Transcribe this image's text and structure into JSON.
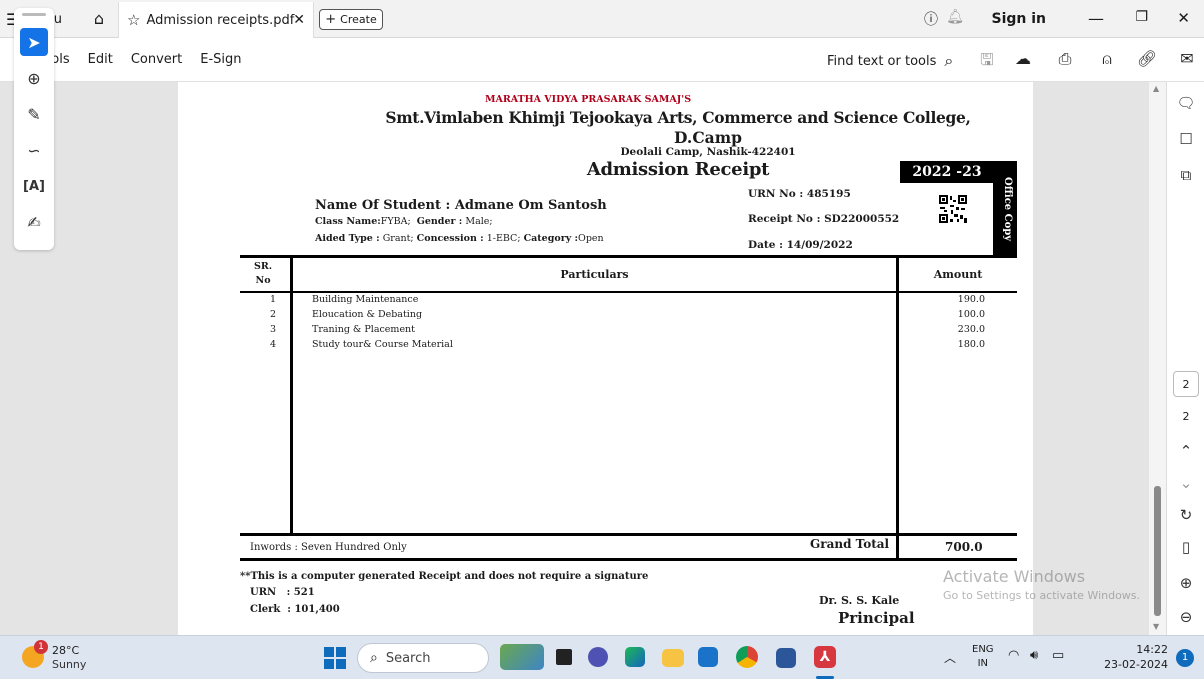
{
  "titlebar": {
    "menu_label": "Menu",
    "tab_title": "Admission receipts.pdf",
    "create_label": "Create",
    "sign_in": "Sign in"
  },
  "toolbar": {
    "items": [
      "All tools",
      "Edit",
      "Convert",
      "E-Sign"
    ],
    "find_label": "Find text or tools"
  },
  "page_nav": {
    "current_page": "2",
    "total_pages": "2"
  },
  "receipt": {
    "society": "MARATHA VIDYA PRASARAK SAMAJ'S",
    "college_line1": "Smt.Vimlaben Khimji Tejookaya Arts, Commerce and Science College,",
    "college_line2": "D.Camp",
    "address": "Deolali Camp, Nashik-422401",
    "title": "Admission Receipt",
    "year": "2022 -23",
    "copy_label": "Office Copy",
    "student_name": "Name Of Student : Admane Om Santosh",
    "class_prefix": "Class Name:",
    "class_value": "FYBA;",
    "gender_prefix": "Gender :",
    "gender_value": "Male;",
    "aided_prefix": "Aided Type :",
    "aided_value": "Grant;",
    "concession_prefix": "Concession :",
    "concession_value": "1-EBC;",
    "category_prefix": "Category :",
    "category_value": "Open",
    "urn_no": "URN No : 485195",
    "receipt_no": "Receipt No : SD22000552",
    "date": "Date : 14/09/2022",
    "table_headers": {
      "sr_line1": "SR.",
      "sr_line2": "No",
      "particulars": "Particulars",
      "amount": "Amount"
    },
    "rows": [
      {
        "sr": "1",
        "particular": "Building Maintenance",
        "amount": "190.0"
      },
      {
        "sr": "2",
        "particular": "Eloucation & Debating",
        "amount": "100.0"
      },
      {
        "sr": "3",
        "particular": "Traning & Placement",
        "amount": "230.0"
      },
      {
        "sr": "4",
        "particular": "Study tour& Course Material",
        "amount": "180.0"
      }
    ],
    "inwords": "Inwords : Seven Hundred Only",
    "grand_total_label": "Grand Total",
    "grand_total_value": "700.0",
    "note": "**This is a computer generated Receipt and does not require a signature",
    "urn_label": "URN",
    "urn_value": ": 521",
    "clerk_label": "Clerk",
    "clerk_value": ": 101,400",
    "signatory_name": "Dr. S. S. Kale",
    "signatory_title": "Principal"
  },
  "watermark": {
    "line1": "Activate Windows",
    "line2": "Go to Settings to activate Windows."
  },
  "taskbar": {
    "weather_temp": "28°C",
    "weather_desc": "Sunny",
    "weather_badge": "1",
    "search_label": "Search",
    "lang_line1": "ENG",
    "lang_line2": "IN",
    "time": "14:22",
    "date": "23-02-2024",
    "notif_count": "1"
  }
}
